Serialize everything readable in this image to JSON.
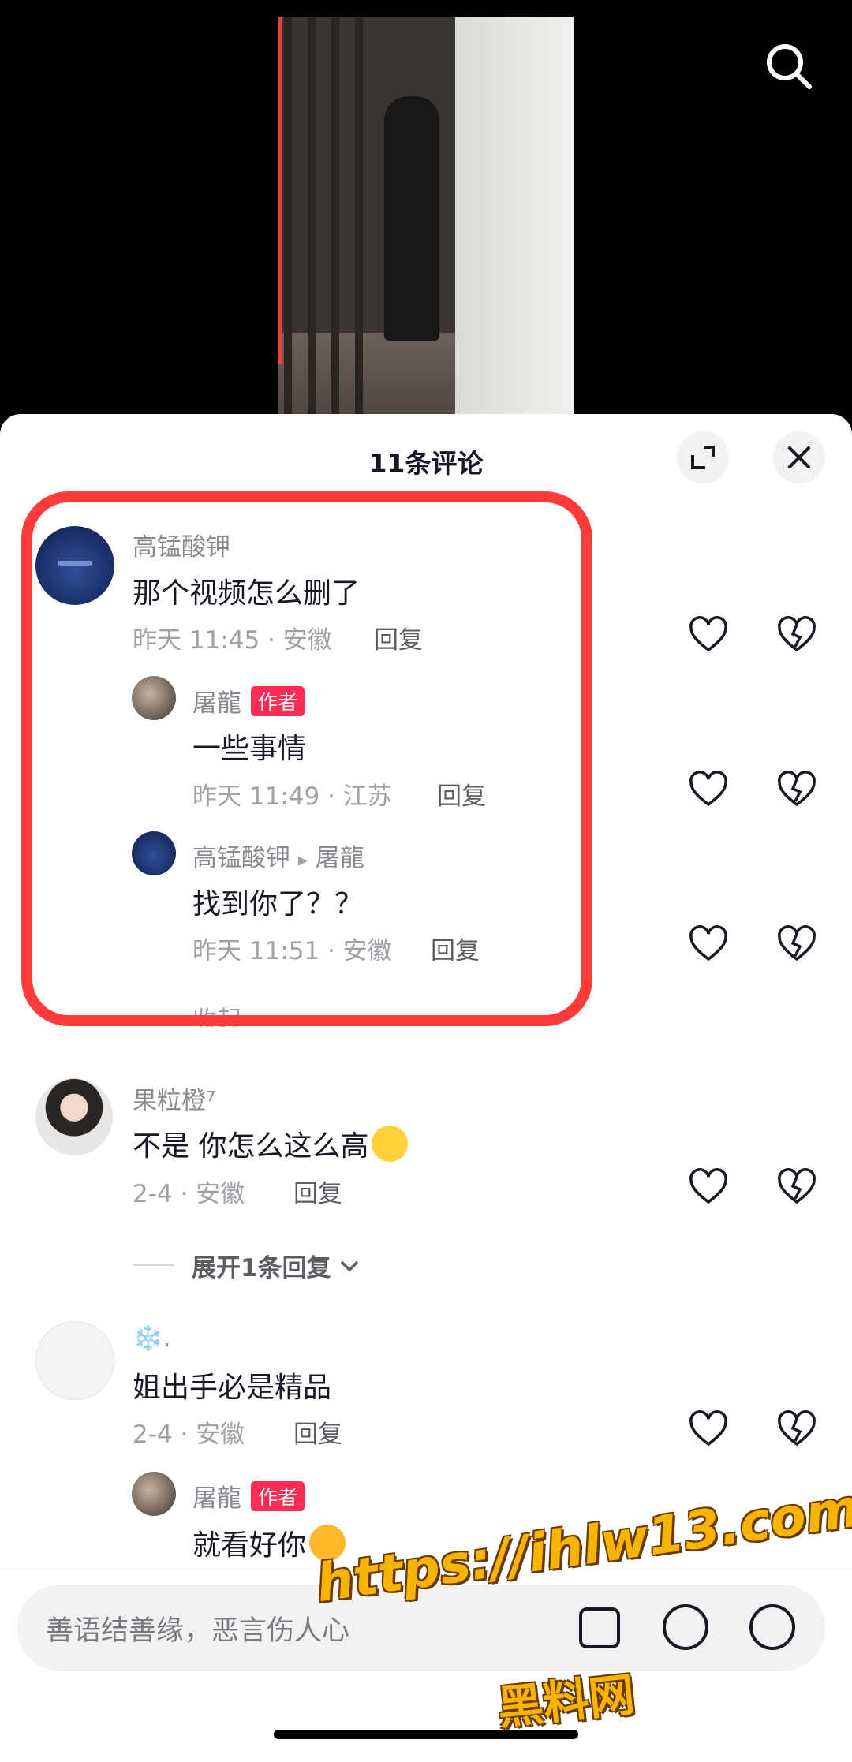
{
  "header": {
    "title": "11条评论"
  },
  "comments": [
    {
      "name": "高锰酸钾",
      "text": "那个视频怎么删了",
      "meta": "昨天 11:45 · 安徽",
      "reply": "回复"
    },
    {
      "name": "屠龍",
      "badge": "作者",
      "text": "一些事情",
      "meta": "昨天 11:49 · 江苏",
      "reply": "回复"
    },
    {
      "name": "高锰酸钾",
      "arrow": "▸",
      "reply_to": "屠龍",
      "text": "找到你了？？",
      "meta": "昨天 11:51 · 安徽",
      "reply": "回复"
    },
    {
      "name": "果粒橙⁷",
      "text": "不是 你怎么这么高",
      "meta": "2-4 · 安徽",
      "reply": "回复"
    },
    {
      "name": "❄️.",
      "text": "姐出手必是精品",
      "meta": "2-4 · 安徽",
      "reply": "回复"
    },
    {
      "name": "屠龍",
      "badge": "作者",
      "text": "就看好你"
    }
  ],
  "collapse_label": "收起",
  "expand_label": "展开1条回复",
  "input": {
    "placeholder": "善语结善缘，恶言伤人心"
  },
  "watermark": {
    "url": "https://ihlw13.com",
    "text": "黑料网"
  },
  "colors": {
    "accent": "#fe2c55",
    "highlight": "#ff3b3b"
  }
}
